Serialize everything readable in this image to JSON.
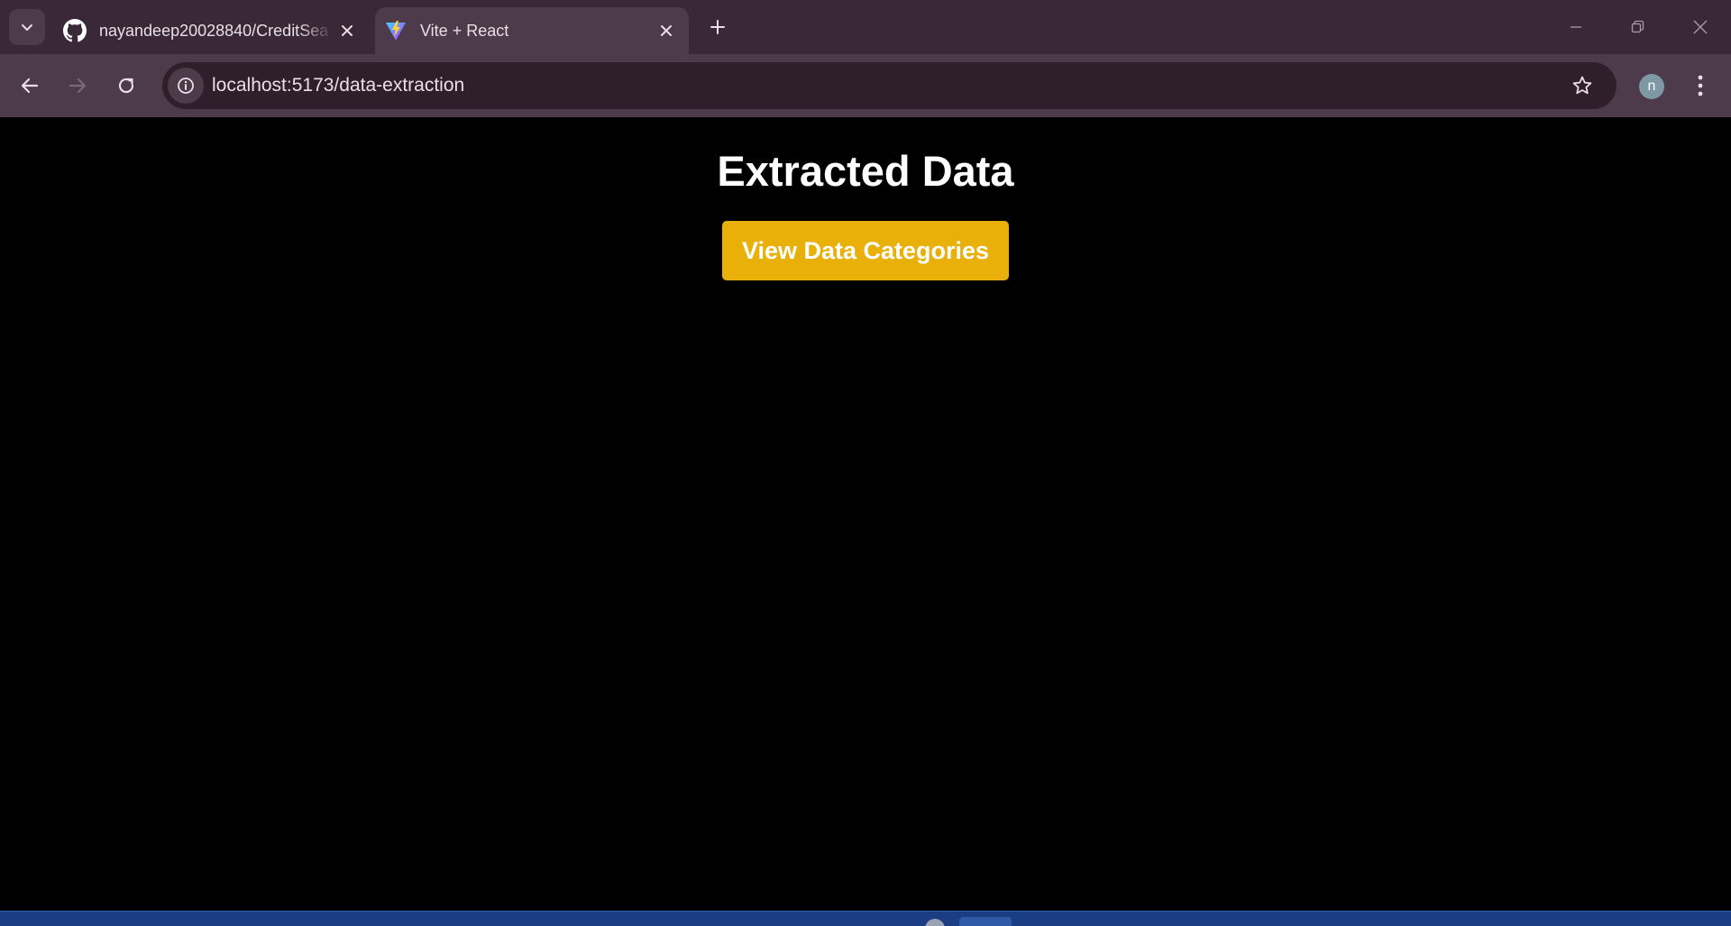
{
  "browser": {
    "tabs": [
      {
        "title": "nayandeep20028840/CreditSea",
        "favicon": "github-icon",
        "active": false
      },
      {
        "title": "Vite + React",
        "favicon": "vite-icon",
        "active": true
      }
    ],
    "address_bar": {
      "url": "localhost:5173/data-extraction"
    },
    "profile_initial": "n",
    "theme": {
      "tabstrip": "#3a2838",
      "toolbar": "#4d3a4a",
      "omnibox": "#2f1f2d"
    }
  },
  "page": {
    "title": "Extracted Data",
    "primary_button": {
      "label": "View Data Categories",
      "color": "#e8b008"
    },
    "background": "#000000"
  }
}
